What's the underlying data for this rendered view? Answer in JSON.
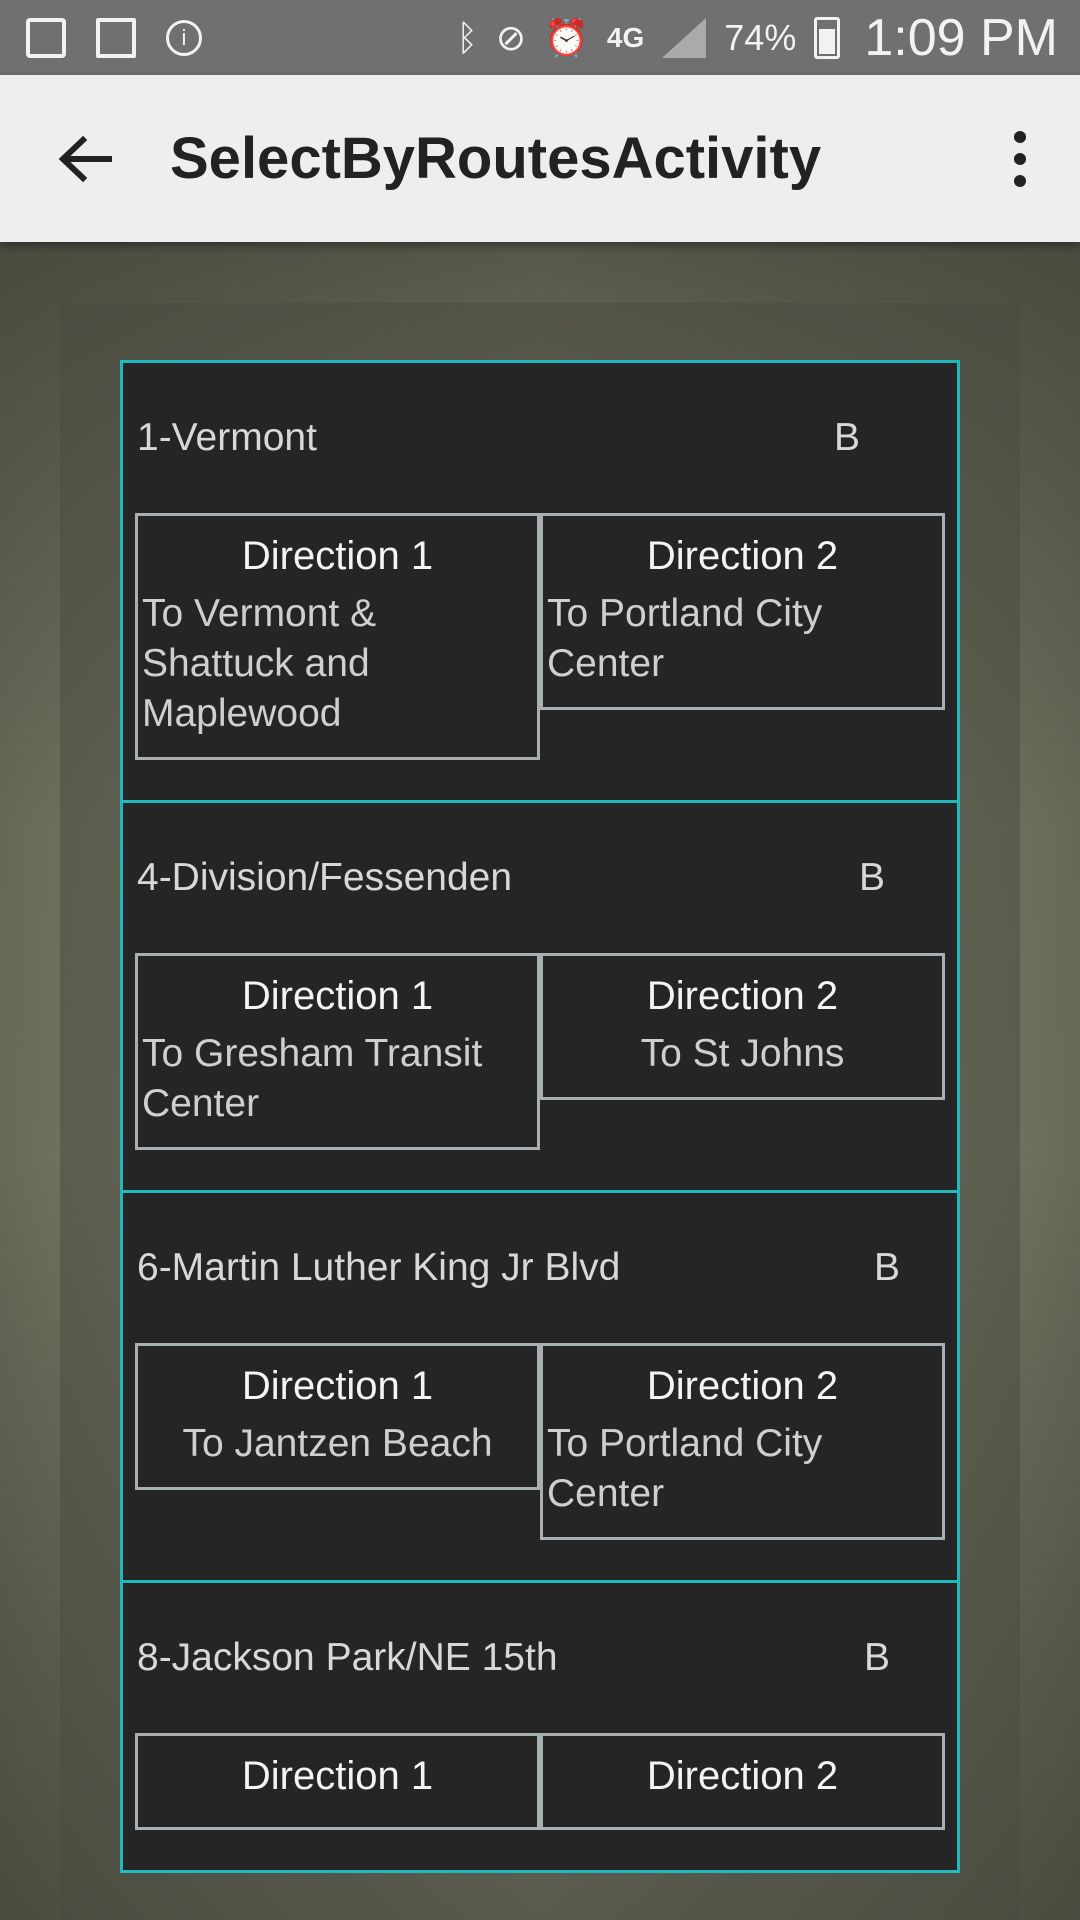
{
  "status_bar": {
    "battery": "74%",
    "time": "1:09 PM",
    "network": "4G",
    "icons": [
      "gallery-icon",
      "sync-icon",
      "info-icon",
      "bluetooth-icon",
      "mute-vibrate-icon",
      "alarm-icon",
      "network-4g-icon",
      "signal-icon",
      "battery-icon"
    ]
  },
  "app_bar": {
    "title": "SelectByRoutesActivity",
    "back_icon": "arrow-left-icon",
    "menu_icon": "more-vert-icon"
  },
  "routes": [
    {
      "name": "1-Vermont",
      "badge": "B",
      "directions": [
        {
          "title": "Direction 1",
          "dest": "To Vermont & Shattuck and Maplewood"
        },
        {
          "title": "Direction 2",
          "dest": "To Portland City Center"
        }
      ]
    },
    {
      "name": "4-Division/Fessenden",
      "badge": "B",
      "directions": [
        {
          "title": "Direction 1",
          "dest": "To Gresham Transit Center"
        },
        {
          "title": "Direction 2",
          "dest": "To St Johns"
        }
      ]
    },
    {
      "name": "6-Martin Luther King Jr Blvd",
      "badge": "B",
      "directions": [
        {
          "title": "Direction 1",
          "dest": "To Jantzen Beach"
        },
        {
          "title": "Direction 2",
          "dest": "To Portland City Center"
        }
      ]
    },
    {
      "name": "8-Jackson Park/NE 15th",
      "badge": "B",
      "directions": [
        {
          "title": "Direction 1",
          "dest": ""
        },
        {
          "title": "Direction 2",
          "dest": ""
        }
      ]
    }
  ],
  "colors": {
    "accent": "#1fb8bd",
    "card_bg": "#252525",
    "app_bar_bg": "#eeeeee",
    "status_bar_bg": "#707070"
  }
}
